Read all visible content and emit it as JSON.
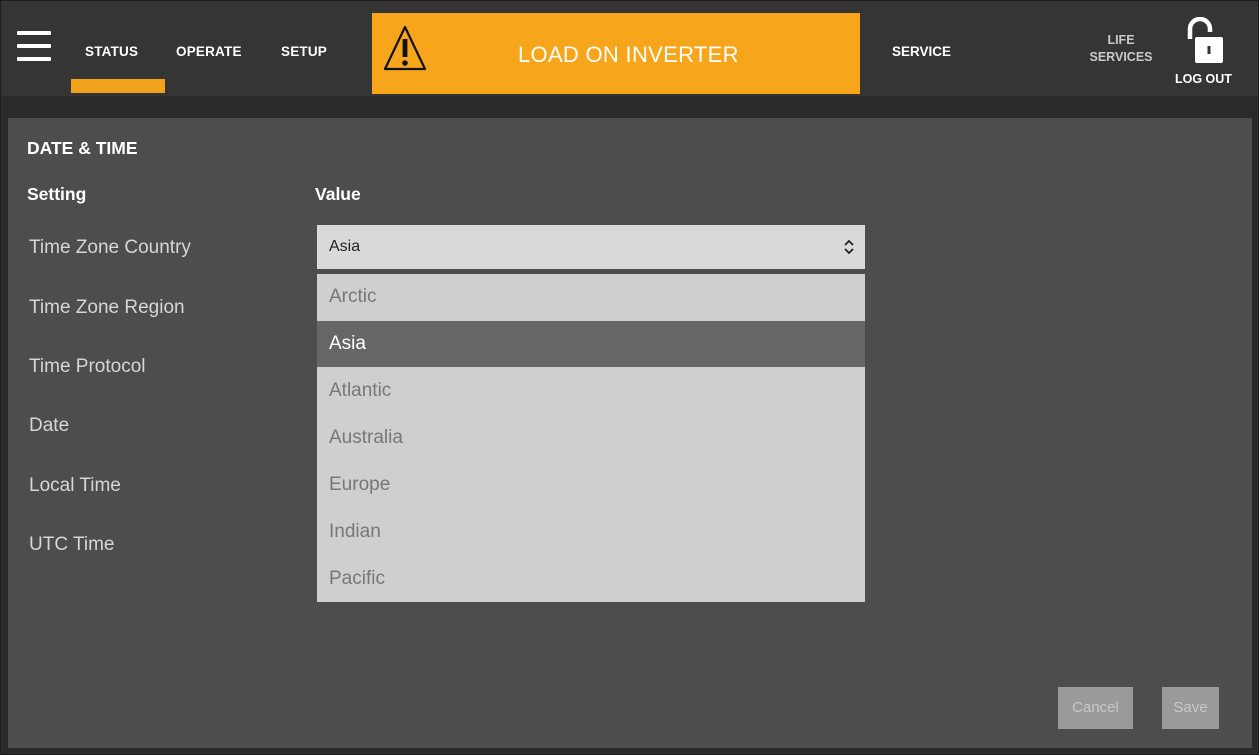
{
  "nav": {
    "tabs": [
      "STATUS",
      "OPERATE",
      "SETUP"
    ],
    "active_tab": "STATUS",
    "service": "SERVICE",
    "life_services": [
      "LIFE",
      "SERVICES"
    ],
    "logout": "LOG OUT"
  },
  "alert": {
    "text": "LOAD ON INVERTER",
    "icon": "warning-icon",
    "color": "#f7a61c"
  },
  "section": {
    "title": "DATE & TIME",
    "col_setting": "Setting",
    "col_value": "Value"
  },
  "settings": [
    "Time Zone Country",
    "Time Zone Region",
    "Time Protocol",
    "Date",
    "Local Time",
    "UTC Time"
  ],
  "select": {
    "value": "Asia",
    "icon": "chevron-updown-icon"
  },
  "dropdown": {
    "options": [
      "Arctic",
      "Asia",
      "Atlantic",
      "Australia",
      "Europe",
      "Indian",
      "Pacific"
    ],
    "selected": "Asia"
  },
  "buttons": {
    "cancel": "Cancel",
    "save": "Save"
  },
  "colors": {
    "accent": "#f3a21e",
    "topbar": "#353535",
    "panel": "#4d4d4d"
  }
}
